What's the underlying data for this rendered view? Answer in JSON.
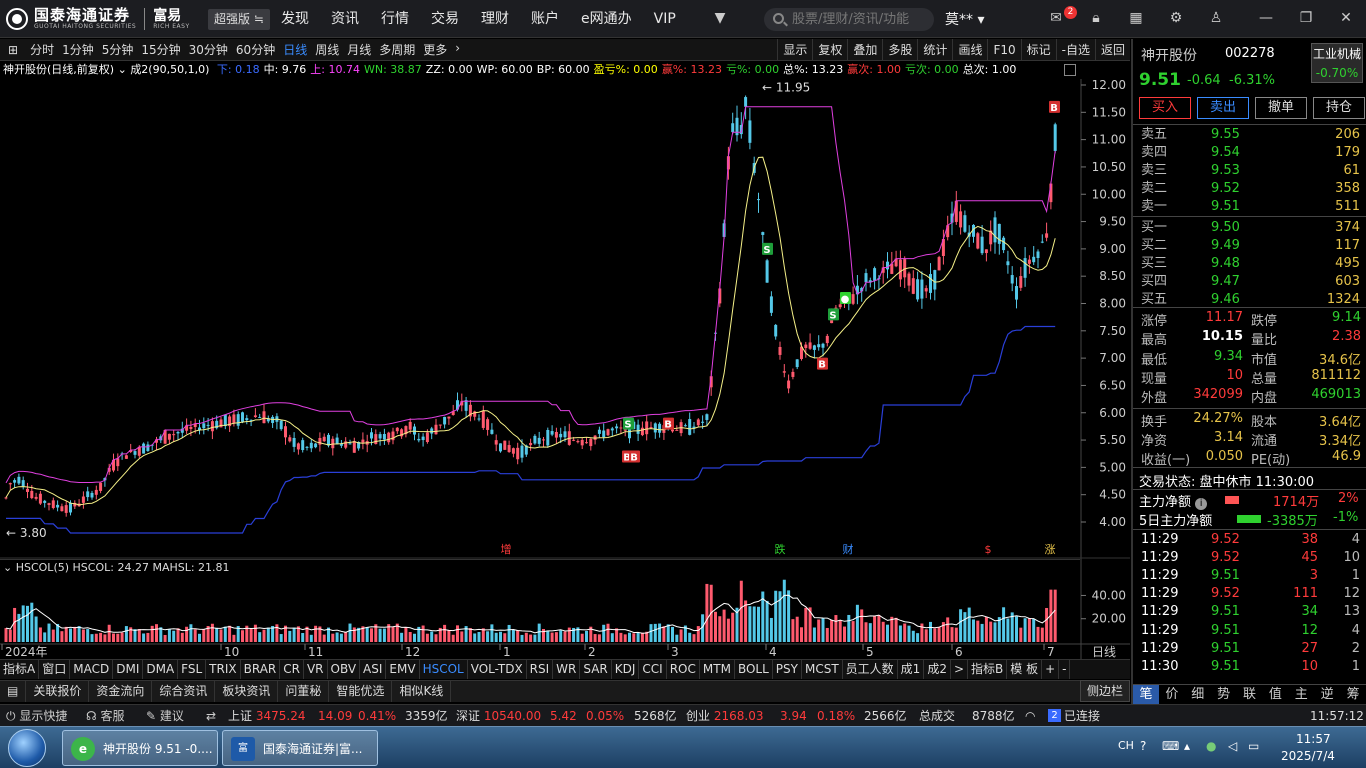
{
  "topbar": {
    "logo_cn": "国泰海通证券",
    "logo_en": "GUOTAI HAITONG SECURITIES",
    "brand_cn": "富易",
    "brand_en": "RICH EASY",
    "edition": "超强版",
    "nav": [
      "发现",
      "资讯",
      "行情",
      "交易",
      "理财",
      "账户",
      "e网通办",
      "VIP"
    ],
    "search_placeholder": "股票/理财/资讯/功能",
    "user": "莫**",
    "mail_badge": "2"
  },
  "periods": [
    "分时",
    "1分钟",
    "5分钟",
    "15分钟",
    "30分钟",
    "60分钟",
    "日线",
    "周线",
    "月线",
    "多周期",
    "更多"
  ],
  "active_period": "日线",
  "tools": [
    "显示",
    "复权",
    "叠加",
    "多股",
    "统计",
    "画线",
    "F10",
    "标记",
    "-自选",
    "返回"
  ],
  "infoline": {
    "name": "神开股份(日线,前复权)",
    "formula": "成2(90,50,1,0)",
    "items": [
      {
        "t": "下: 0.18",
        "c": "#3a6bff"
      },
      {
        "t": "中: 9.76",
        "c": "#ffffff"
      },
      {
        "t": "上: 10.74",
        "c": "#ff44ff"
      },
      {
        "t": "WN: 38.87",
        "c": "#2fd12f"
      },
      {
        "t": "ZZ: 0.00",
        "c": "#ffffff"
      },
      {
        "t": "WP: 60.00",
        "c": "#ffffff"
      },
      {
        "t": "BP: 60.00",
        "c": "#ffffff"
      },
      {
        "t": "盈亏%: 0.00",
        "c": "#ffff00"
      },
      {
        "t": "赢%: 13.23",
        "c": "#ff3b3b"
      },
      {
        "t": "亏%: 0.00",
        "c": "#2fd12f"
      },
      {
        "t": "总%: 13.23",
        "c": "#ffffff"
      },
      {
        "t": "赢次: 1.00",
        "c": "#ff3b3b"
      },
      {
        "t": "亏次: 0.00",
        "c": "#2fd12f"
      },
      {
        "t": "总次: 1.00",
        "c": "#ffffff"
      }
    ]
  },
  "chart_data": {
    "type": "candlestick",
    "price_axis": [
      "12.00",
      "11.50",
      "11.00",
      "10.50",
      "10.00",
      "9.50",
      "9.00",
      "8.50",
      "8.00",
      "7.50",
      "7.00",
      "6.50",
      "6.00",
      "5.50",
      "5.00",
      "4.50",
      "4.00"
    ],
    "ylim": [
      3.8,
      12.1
    ],
    "months": [
      "2024年",
      "10",
      "11",
      "12",
      "1",
      "2",
      "3",
      "4",
      "5",
      "6",
      "7"
    ],
    "high_label": "11.95",
    "low_label": "3.80",
    "event_marks": [
      "增",
      "跌",
      "财",
      "$",
      "涨"
    ],
    "volume_axis": [
      "40.00",
      "20.00"
    ],
    "volume_indicator": {
      "name": "HSCOL(5)",
      "hscol": "HSCOL: 24.27",
      "mahsl": "MAHSL: 21.81"
    },
    "axis_label": "日线"
  },
  "indicators": [
    "指标A",
    "窗口",
    "MACD",
    "DMI",
    "DMA",
    "FSL",
    "TRIX",
    "BRAR",
    "CR",
    "VR",
    "OBV",
    "ASI",
    "EMV",
    "HSCOL",
    "VOL-TDX",
    "RSI",
    "WR",
    "SAR",
    "KDJ",
    "CCI",
    "ROC",
    "MTM",
    "BOLL",
    "PSY",
    "MCST",
    "员工人数",
    "成1",
    "成2",
    ">",
    "指标B",
    "模 板",
    "+",
    "-"
  ],
  "active_indicator": "HSCOL",
  "subtabs": [
    "关联报价",
    "资金流向",
    "综合资讯",
    "板块资讯",
    "问董秘",
    "智能优选",
    "相似K线"
  ],
  "sidebar_btn": "侧边栏",
  "quote": {
    "name": "神开股份",
    "code": "002278",
    "sector": "工业机械",
    "sector_chg": "-0.70%",
    "price": "9.51",
    "chg": "-0.64",
    "pct": "-6.31%",
    "actions": [
      "买入",
      "卖出",
      "撤单",
      "持仓"
    ],
    "asks": [
      {
        "l": "卖五",
        "p": "9.55",
        "v": "206"
      },
      {
        "l": "卖四",
        "p": "9.54",
        "v": "179"
      },
      {
        "l": "卖三",
        "p": "9.53",
        "v": "61"
      },
      {
        "l": "卖二",
        "p": "9.52",
        "v": "358"
      },
      {
        "l": "卖一",
        "p": "9.51",
        "v": "511"
      }
    ],
    "bids": [
      {
        "l": "买一",
        "p": "9.50",
        "v": "374"
      },
      {
        "l": "买二",
        "p": "9.49",
        "v": "117"
      },
      {
        "l": "买三",
        "p": "9.48",
        "v": "495"
      },
      {
        "l": "买四",
        "p": "9.47",
        "v": "603"
      },
      {
        "l": "买五",
        "p": "9.46",
        "v": "1324"
      }
    ],
    "stats": [
      [
        {
          "l": "涨停",
          "v": "11.17",
          "c": "#ff3b3b"
        },
        {
          "l": "跌停",
          "v": "9.14",
          "c": "#2fd12f"
        }
      ],
      [
        {
          "l": "最高",
          "v": "10.15",
          "c": "#ffffff"
        },
        {
          "l": "量比",
          "v": "2.38",
          "c": "#ff3b3b"
        }
      ],
      [
        {
          "l": "最低",
          "v": "9.34",
          "c": "#2fd12f"
        },
        {
          "l": "市值",
          "v": "34.6亿",
          "c": "#e6c34a"
        }
      ],
      [
        {
          "l": "现量",
          "v": "10",
          "c": "#ff3b3b"
        },
        {
          "l": "总量",
          "v": "811112",
          "c": "#e6c34a"
        }
      ],
      [
        {
          "l": "外盘",
          "v": "342099",
          "c": "#ff3b3b"
        },
        {
          "l": "内盘",
          "v": "469013",
          "c": "#2fd12f"
        }
      ],
      [
        {
          "l": "换手",
          "v": "24.27%",
          "c": "#e6c34a"
        },
        {
          "l": "股本",
          "v": "3.64亿",
          "c": "#e6c34a"
        }
      ],
      [
        {
          "l": "净资",
          "v": "3.14",
          "c": "#e6c34a"
        },
        {
          "l": "流通",
          "v": "3.34亿",
          "c": "#e6c34a"
        }
      ],
      [
        {
          "l": "收益(一)",
          "v": "0.050",
          "c": "#e6c34a"
        },
        {
          "l": "PE(动)",
          "v": "46.9",
          "c": "#e6c34a"
        }
      ]
    ],
    "trade_status": "交易状态: 盘中休市 11:30:00",
    "main_flow_label": "主力净额",
    "main_flow": "1714万",
    "main_flow_pct": "2%",
    "flow5_label": "5日主力净额",
    "flow5": "-3385万",
    "flow5_pct": "-1%",
    "ticks": [
      {
        "t": "11:29",
        "p": "9.52",
        "v": "38",
        "n": "4",
        "pc": "#ff3b3b",
        "vc": "#ff3b3b"
      },
      {
        "t": "11:29",
        "p": "9.52",
        "v": "45",
        "n": "10",
        "pc": "#ff3b3b",
        "vc": "#ff3b3b"
      },
      {
        "t": "11:29",
        "p": "9.51",
        "v": "3",
        "n": "1",
        "pc": "#2fd12f",
        "vc": "#ff3b3b"
      },
      {
        "t": "11:29",
        "p": "9.52",
        "v": "111",
        "n": "12",
        "pc": "#ff3b3b",
        "vc": "#ff3b3b"
      },
      {
        "t": "11:29",
        "p": "9.51",
        "v": "34",
        "n": "13",
        "pc": "#2fd12f",
        "vc": "#2fd12f"
      },
      {
        "t": "11:29",
        "p": "9.51",
        "v": "12",
        "n": "4",
        "pc": "#2fd12f",
        "vc": "#2fd12f"
      },
      {
        "t": "11:29",
        "p": "9.51",
        "v": "27",
        "n": "2",
        "pc": "#2fd12f",
        "vc": "#ff3b3b"
      },
      {
        "t": "11:30",
        "p": "9.51",
        "v": "10",
        "n": "1",
        "pc": "#2fd12f",
        "vc": "#ff3b3b"
      }
    ],
    "bottom_tabs": [
      "笔",
      "价",
      "细",
      "势",
      "联",
      "值",
      "主",
      "逆",
      "筹"
    ]
  },
  "status": {
    "quick": "显示快捷",
    "service": "客服",
    "suggest": "建议",
    "sh_label": "上证",
    "sh": "3475.24",
    "sh_chg": "14.09",
    "sh_pct": "0.41%",
    "sh_amt": "3359亿",
    "sz_label": "深证",
    "sz": "10540.00",
    "sz_chg": "5.42",
    "sz_pct": "0.05%",
    "sz_amt": "5268亿",
    "cy_label": "创业",
    "cy": "2168.03",
    "cy_chg": "3.94",
    "cy_pct": "0.18%",
    "cy_amt": "2566亿",
    "total_label": "总成交",
    "total": "8788亿",
    "conn_count": "2",
    "conn": "已连接",
    "time": "11:57:12"
  },
  "taskbar": {
    "task1": "神开股份 9.51 -0....",
    "task2": "国泰海通证券|富...",
    "ime": "CH",
    "time": "11:57",
    "date": "2025/7/4"
  }
}
